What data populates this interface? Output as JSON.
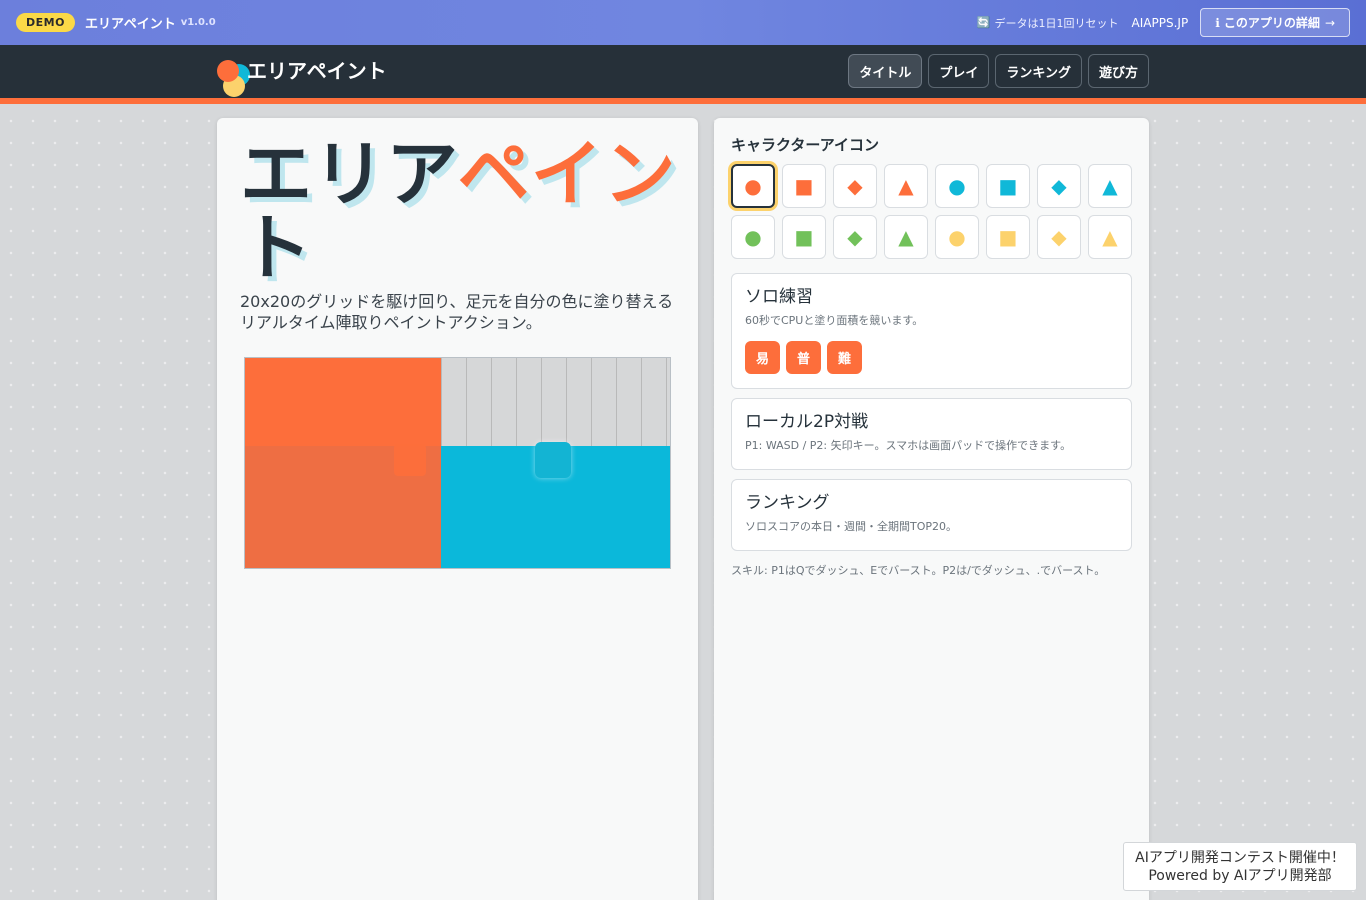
{
  "demo_bar": {
    "badge": "DEMO",
    "app_title": "エリアペイント",
    "version": "v1.0.0",
    "reset_icon": "🔄",
    "reset_note": "データは1日1回リセット",
    "aiapps": "AIAPPS.JP",
    "detail_label": "ℹ このアプリの詳細",
    "detail_arrow": "→"
  },
  "header": {
    "app_name": "エリアペイント",
    "nav": [
      "タイトル",
      "プレイ",
      "ランキング",
      "遊び方"
    ],
    "active_nav": "タイトル"
  },
  "hero": {
    "title_dark": "エリア",
    "title_orange": "ペイ",
    "title_orange2": "ン",
    "title_dark2": "ト",
    "description": "20x20のグリッドを駆け回り、足元を自分の色に塗り替えるリアルタイム陣取りペイントアクション。"
  },
  "character": {
    "heading": "キャラクターアイコン",
    "icons": [
      {
        "glyph": "●",
        "name": "circle-orange-icon",
        "color": "#fd6e3b"
      },
      {
        "glyph": "■",
        "name": "square-orange-icon",
        "color": "#fd6e3b"
      },
      {
        "glyph": "◆",
        "name": "diamond-orange-icon",
        "color": "#fd6e3b"
      },
      {
        "glyph": "▲",
        "name": "triangle-orange-icon",
        "color": "#fd6e3b"
      },
      {
        "glyph": "●",
        "name": "circle-blue-icon",
        "color": "#10b8d8"
      },
      {
        "glyph": "■",
        "name": "square-blue-icon",
        "color": "#10b8d8"
      },
      {
        "glyph": "◆",
        "name": "diamond-blue-icon",
        "color": "#10b8d8"
      },
      {
        "glyph": "▲",
        "name": "triangle-blue-icon",
        "color": "#10b8d8"
      },
      {
        "glyph": "●",
        "name": "circle-green-icon",
        "color": "#72c15a"
      },
      {
        "glyph": "■",
        "name": "square-green-icon",
        "color": "#72c15a"
      },
      {
        "glyph": "◆",
        "name": "diamond-green-icon",
        "color": "#72c15a"
      },
      {
        "glyph": "▲",
        "name": "triangle-green-icon",
        "color": "#72c15a"
      },
      {
        "glyph": "●",
        "name": "circle-yellow-icon",
        "color": "#fcd26c"
      },
      {
        "glyph": "■",
        "name": "square-yellow-icon",
        "color": "#fcd26c"
      },
      {
        "glyph": "◆",
        "name": "diamond-yellow-icon",
        "color": "#fcd26c"
      },
      {
        "glyph": "▲",
        "name": "triangle-yellow-icon",
        "color": "#fcd26c"
      }
    ],
    "selected_index": 0
  },
  "solo": {
    "title": "ソロ練習",
    "desc": "60秒でCPUと塗り面積を競います。",
    "difficulties": [
      "易",
      "普",
      "難"
    ]
  },
  "local": {
    "title": "ローカル2P対戦",
    "desc": "P1: WASD / P2: 矢印キー。スマホは画面パッドで操作できます。"
  },
  "ranking": {
    "title": "ランキング",
    "desc": "ソロスコアの本日・週間・全期間TOP20。"
  },
  "skill_note": "スキル: P1はQでダッシュ、Eでバースト。P2は/でダッシュ、.でバースト。",
  "promo": {
    "line1": "AIアプリ開発コンテスト開催中！",
    "line2": "Powered by AIアプリ開発部"
  },
  "colors": {
    "accent_orange": "#fd6e3b",
    "accent_blue": "#10b8d8",
    "header_dark": "#263039"
  }
}
